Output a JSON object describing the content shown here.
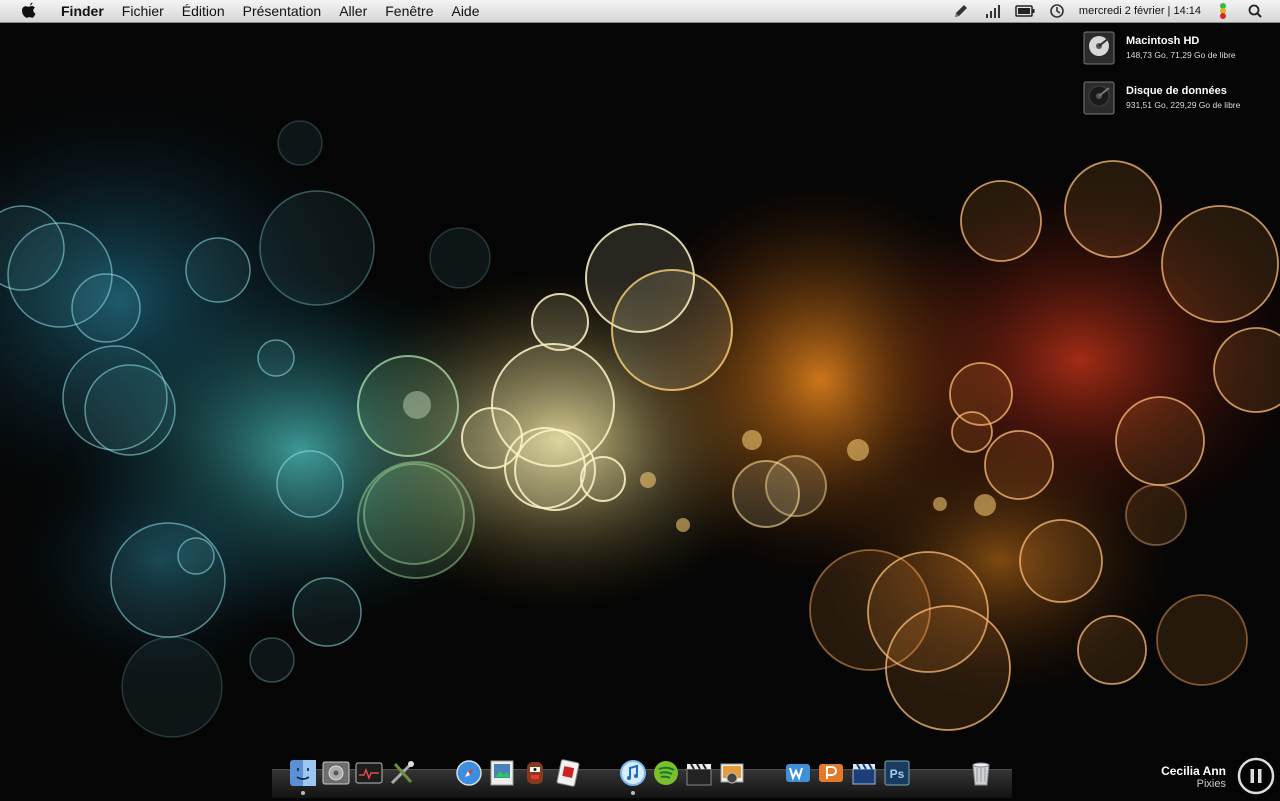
{
  "menubar": {
    "apple_icon": "apple-icon",
    "app_name": "Finder",
    "items": [
      "Fichier",
      "Édition",
      "Présentation",
      "Aller",
      "Fenêtre",
      "Aide"
    ],
    "status_icons": [
      "pencil-icon",
      "signal-bars-icon",
      "battery-icon",
      "time-machine-icon",
      "traffic-light-icon"
    ],
    "clock": "mercredi 2 février | 14:14",
    "spotlight_icon": "spotlight-icon"
  },
  "drives": [
    {
      "name": "Macintosh HD",
      "info": "148,73 Go, 71,29 Go de libre"
    },
    {
      "name": "Disque de données",
      "info": "931,51 Go, 229,29 Go de libre"
    }
  ],
  "dock": {
    "items": [
      {
        "name": "finder-icon",
        "running": true
      },
      {
        "name": "system-preferences-icon",
        "running": false
      },
      {
        "name": "activity-monitor-icon",
        "running": false
      },
      {
        "name": "utility-tools-icon",
        "running": false
      },
      {
        "name": "safari-icon",
        "running": false
      },
      {
        "name": "preview-icon",
        "running": false
      },
      {
        "name": "character-app-icon",
        "running": false
      },
      {
        "name": "script-app-icon",
        "running": false
      },
      {
        "name": "itunes-icon",
        "running": true
      },
      {
        "name": "spotify-icon",
        "running": false
      },
      {
        "name": "movie-clapper-icon",
        "running": false
      },
      {
        "name": "iphoto-icon",
        "running": false
      },
      {
        "name": "word-icon",
        "running": false
      },
      {
        "name": "powerpoint-icon",
        "running": false
      },
      {
        "name": "final-cut-icon",
        "running": false
      },
      {
        "name": "photoshop-icon",
        "running": false,
        "label": "Ps"
      },
      {
        "name": "trash-icon",
        "running": false
      }
    ]
  },
  "user_widget": {
    "name": "Cecilia Ann",
    "subtitle": "Pixies",
    "pause_icon": "pause-icon"
  }
}
